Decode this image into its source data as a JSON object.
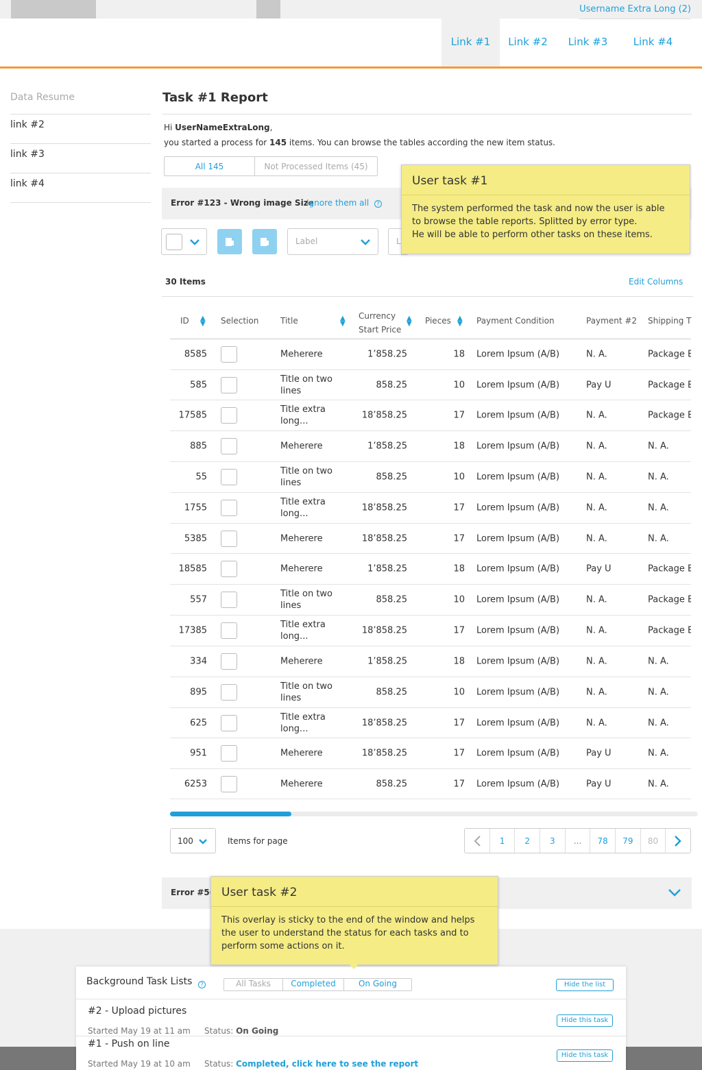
{
  "header": {
    "user": "Username Extra Long (2)",
    "nav": [
      "Link #1",
      "Link #2",
      "Link #3",
      "Link #4"
    ]
  },
  "sidebar": {
    "title": "Data Resume",
    "items": [
      "link #2",
      "link #3",
      "link #4"
    ]
  },
  "main": {
    "title": "Task #1 Report",
    "greet_prefix": "Hi ",
    "username": "UserNameExtraLong",
    "greet_suffix": ",",
    "line2_a": "you started a process for ",
    "count": "145",
    "line2_b": " items. You can browse the tables according the new item status.",
    "tabs": [
      "All 145",
      "Not Processed Items (45)"
    ],
    "error_title": "Error #123 - Wrong image Size",
    "ignore_link": "Ignore them all",
    "label_placeholder": "Label",
    "items_count": "30 Items",
    "edit_columns": "Edit Columns",
    "columns": {
      "id": "ID",
      "selection": "Selection",
      "title": "Title",
      "currency_1": "Currency",
      "currency_2": "Start Price",
      "pieces": "Pieces",
      "payment_condition": "Payment Condition",
      "payment2": "Payment #2",
      "shipping": "Shipping T"
    },
    "rows": [
      {
        "id": "8585",
        "title1": "Meherere",
        "title2": "",
        "price": "1’858.25",
        "pieces": "18",
        "cond": "Lorem Ipsum (A/B)",
        "pay": "N. A.",
        "ship": "Package E"
      },
      {
        "id": "585",
        "title1": "Title on two",
        "title2": "lines",
        "price": "858.25",
        "pieces": "10",
        "cond": "Lorem Ipsum (A/B)",
        "pay": "Pay U",
        "ship": "Package E"
      },
      {
        "id": "17585",
        "title1": "Title extra",
        "title2": "long...",
        "price": "18’858.25",
        "pieces": "17",
        "cond": "Lorem Ipsum (A/B)",
        "pay": "N. A.",
        "ship": "Package E"
      },
      {
        "id": "885",
        "title1": "Meherere",
        "title2": "",
        "price": "1’858.25",
        "pieces": "18",
        "cond": "Lorem Ipsum (A/B)",
        "pay": "N. A.",
        "ship": "N. A."
      },
      {
        "id": "55",
        "title1": "Title on two",
        "title2": "lines",
        "price": "858.25",
        "pieces": "10",
        "cond": "Lorem Ipsum (A/B)",
        "pay": "N. A.",
        "ship": "N. A."
      },
      {
        "id": "1755",
        "title1": "Title extra",
        "title2": "long...",
        "price": "18’858.25",
        "pieces": "17",
        "cond": "Lorem Ipsum (A/B)",
        "pay": "N. A.",
        "ship": "N. A."
      },
      {
        "id": "5385",
        "title1": "Meherere",
        "title2": "",
        "price": "18’858.25",
        "pieces": "17",
        "cond": "Lorem Ipsum (A/B)",
        "pay": "N. A.",
        "ship": "N. A."
      },
      {
        "id": "18585",
        "title1": "Meherere",
        "title2": "",
        "price": "1’858.25",
        "pieces": "18",
        "cond": "Lorem Ipsum (A/B)",
        "pay": "Pay U",
        "ship": "Package E"
      },
      {
        "id": "557",
        "title1": "Title on two",
        "title2": "lines",
        "price": "858.25",
        "pieces": "10",
        "cond": "Lorem Ipsum (A/B)",
        "pay": "N. A.",
        "ship": "Package E"
      },
      {
        "id": "17385",
        "title1": "Title extra",
        "title2": "long...",
        "price": "18’858.25",
        "pieces": "17",
        "cond": "Lorem Ipsum (A/B)",
        "pay": "N. A.",
        "ship": "Package E"
      },
      {
        "id": "334",
        "title1": "Meherere",
        "title2": "",
        "price": "1’858.25",
        "pieces": "18",
        "cond": "Lorem Ipsum (A/B)",
        "pay": "N. A.",
        "ship": "N. A."
      },
      {
        "id": "895",
        "title1": "Title on two",
        "title2": "lines",
        "price": "858.25",
        "pieces": "10",
        "cond": "Lorem Ipsum (A/B)",
        "pay": "N. A.",
        "ship": "N. A."
      },
      {
        "id": "625",
        "title1": "Title extra",
        "title2": "long...",
        "price": "18’858.25",
        "pieces": "17",
        "cond": "Lorem Ipsum (A/B)",
        "pay": "N. A.",
        "ship": "N. A."
      },
      {
        "id": "951",
        "title1": "Meherere",
        "title2": "",
        "price": "18’858.25",
        "pieces": "17",
        "cond": "Lorem Ipsum (A/B)",
        "pay": "Pay U",
        "ship": "N. A."
      },
      {
        "id": "6253",
        "title1": "Meherere",
        "title2": "",
        "price": "858.25",
        "pieces": "17",
        "cond": "Lorem Ipsum (A/B)",
        "pay": "Pay U",
        "ship": "N. A."
      }
    ],
    "horizontal_scroll_fraction": 0.23,
    "per_page": "100",
    "per_page_label": "Items for page",
    "pages": [
      "1",
      "2",
      "3",
      "...",
      "78",
      "79",
      "80"
    ],
    "error2_title": "Error #56"
  },
  "callouts": {
    "task1": {
      "title": "User task #1",
      "lines": [
        "The system performed the task and now the user is able",
        "to browse the table reports. Splitted by error type.",
        "He will be able to perform other tasks on these items."
      ]
    },
    "task2": {
      "title": "User task #2",
      "lines": [
        "This overlay is sticky to the end of the window and helps",
        "the user to understand the status for each tasks and to",
        "perform some actions on it."
      ]
    }
  },
  "background_tasks": {
    "title": "Background Task Lists",
    "filters": [
      "All Tasks",
      "Completed",
      "On Going"
    ],
    "hide_list": "Hide the list",
    "tasks": [
      {
        "name": "#2 - Upload pictures",
        "started": "Started May 19 at 11 am",
        "status_label": "Status: ",
        "status": "On Going",
        "hide": "Hide this task"
      },
      {
        "name": "#1 - Push on line",
        "started": "Started May 19 at 10 am",
        "status_label": "Status: ",
        "status": "Completed, click here to see the report",
        "hide": "Hide this task"
      }
    ]
  },
  "colors": {
    "accent": "#1fa0d9",
    "orange": "#f29a36",
    "callout": "#f5ec85"
  }
}
